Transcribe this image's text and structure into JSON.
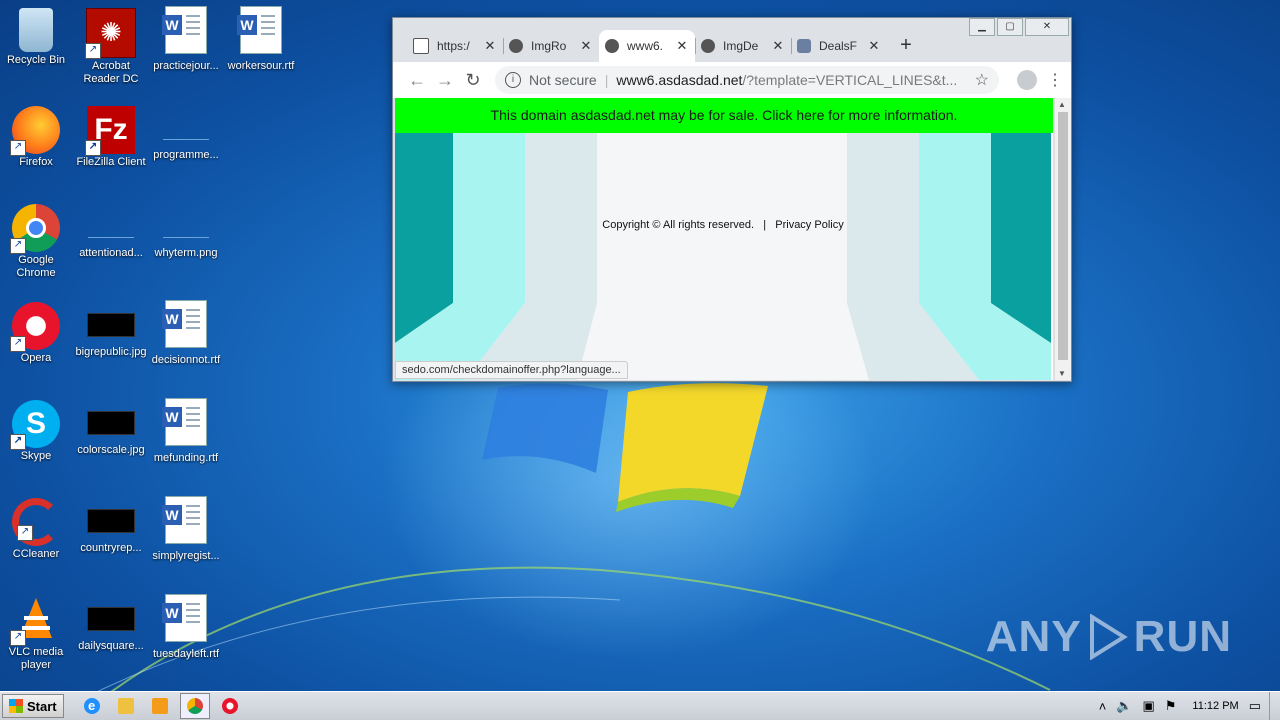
{
  "desktop": {
    "icons": [
      {
        "label": "Recycle Bin"
      },
      {
        "label": "Acrobat Reader DC"
      },
      {
        "label": "practicejour..."
      },
      {
        "label": "workersour.rtf"
      },
      {
        "label": "Firefox"
      },
      {
        "label": "FileZilla Client"
      },
      {
        "label": "programme..."
      },
      {
        "label": "Google Chrome"
      },
      {
        "label": "attentionad..."
      },
      {
        "label": "whyterm.png"
      },
      {
        "label": "Opera"
      },
      {
        "label": "bigrepublic.jpg"
      },
      {
        "label": "decisionnot.rtf"
      },
      {
        "label": "Skype"
      },
      {
        "label": "colorscale.jpg"
      },
      {
        "label": "mefunding.rtf"
      },
      {
        "label": "CCleaner"
      },
      {
        "label": "countryrep..."
      },
      {
        "label": "simplyregist..."
      },
      {
        "label": "VLC media player"
      },
      {
        "label": "dailysquare..."
      },
      {
        "label": "tuesdayleft.rtf"
      }
    ],
    "watermark": "ANY RUN"
  },
  "browser": {
    "tabs": [
      {
        "title": "https:/"
      },
      {
        "title": "ImgRo"
      },
      {
        "title": "www6."
      },
      {
        "title": "ImgDe"
      },
      {
        "title": "DealsF"
      }
    ],
    "new_tab": "+",
    "omnibox": {
      "security": "Not secure",
      "host": "www6.asdasdad.net",
      "path": "/?template=VERTICAL_LINES&t..."
    },
    "page": {
      "banner": "This domain asdasdad.net may be for sale. Click here for more information.",
      "copyright": "Copyright © All rights reserved.",
      "divider": "|",
      "privacy": "Privacy Policy"
    },
    "status_url": "sedo.com/checkdomainoffer.php?language..."
  },
  "taskbar": {
    "start_label": "Start",
    "clock": "11:12 PM"
  }
}
